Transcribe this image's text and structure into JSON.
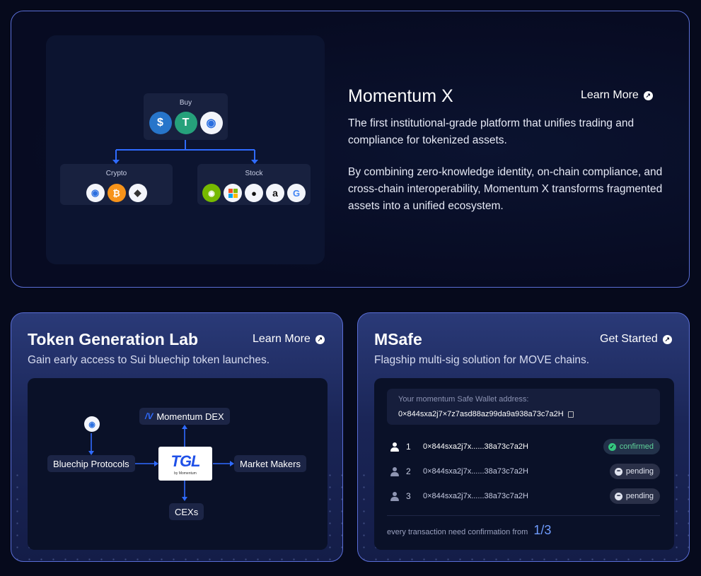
{
  "momentum_x": {
    "title": "Momentum X",
    "link": "Learn More",
    "desc1": "The first institutional-grade platform that unifies trading and compliance for tokenized assets.",
    "desc2": "By combining zero-knowledge identity, on-chain compliance, and cross-chain interoperability, Momentum X transforms fragmented assets into a unified ecosystem.",
    "diagram": {
      "buy_label": "Buy",
      "crypto_label": "Crypto",
      "stock_label": "Stock",
      "buy_icons": [
        "usdc-icon",
        "tether-icon",
        "sui-icon"
      ],
      "crypto_icons": [
        "sui-icon",
        "bitcoin-icon",
        "ethereum-icon"
      ],
      "stock_icons": [
        "nvidia-icon",
        "microsoft-icon",
        "apple-icon",
        "amazon-icon",
        "google-icon"
      ]
    }
  },
  "tgl": {
    "title": "Token Generation Lab",
    "link": "Learn More",
    "subtitle": "Gain early access to Sui bluechip token launches.",
    "diagram": {
      "dex": "Momentum DEX",
      "bluechip": "Bluechip Protocols",
      "makers": "Market Makers",
      "cexs": "CEXs",
      "logo_text": "TGL",
      "logo_by": "by Momentum"
    }
  },
  "msafe": {
    "title": "MSafe",
    "link": "Get Started",
    "subtitle": "Flagship multi-sig solution for MOVE chains.",
    "wallet_label": "Your momentum Safe Wallet address:",
    "wallet_address": "0×844sxa2j7×7z7asd88az99da9a938a73c7a2H",
    "signers": [
      {
        "num": "1",
        "address": "0×844sxa2j7x......38a73c7a2H",
        "status": "confirmed"
      },
      {
        "num": "2",
        "address": "0×844sxa2j7x......38a73c7a2H",
        "status": "pending"
      },
      {
        "num": "3",
        "address": "0×844sxa2j7x......38a73c7a2H",
        "status": "pending"
      }
    ],
    "footer_text": "every transaction need confirmation from",
    "footer_value": "1/3"
  },
  "colors": {
    "accent": "#2f6bff",
    "border": "#5a6ed6",
    "confirmed": "#35c67f"
  }
}
